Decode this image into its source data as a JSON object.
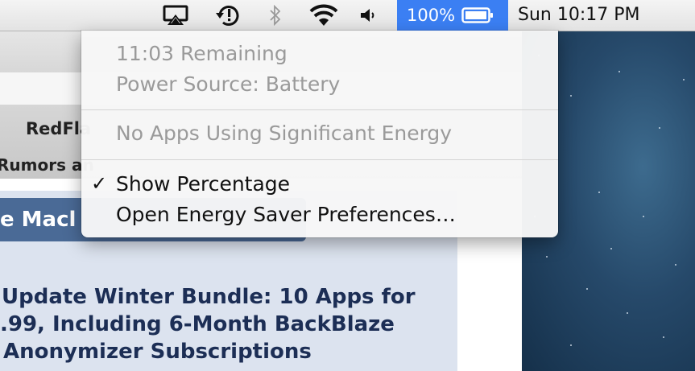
{
  "menubar": {
    "icons": [
      "airplay-icon",
      "time-machine-icon",
      "bluetooth-icon",
      "wifi-icon",
      "volume-icon"
    ],
    "battery": {
      "percentage": "100%",
      "level": 1.0,
      "accent_color": "#3b7ff3"
    },
    "clock": "Sun 10:17 PM"
  },
  "battery_menu": {
    "time_remaining": "11:03 Remaining",
    "power_source": "Power Source: Battery",
    "energy_status": "No Apps Using Significant Energy",
    "show_percentage": {
      "label": "Show Percentage",
      "checked": true,
      "check_glyph": "✓"
    },
    "open_preferences": "Open Energy Saver Preferences…"
  },
  "background_page": {
    "bookmarks": [
      "RedFla",
      "Rumors an"
    ],
    "banner": "e Macl",
    "headline": [
      "Update Winter Bundle: 10 Apps for",
      ".99, Including 6-Month BackBlaze",
      "Anonymizer Subscriptions"
    ]
  }
}
